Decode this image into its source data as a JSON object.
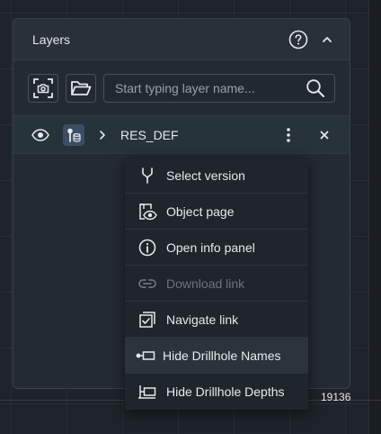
{
  "map": {
    "coordinate_readout": "19136"
  },
  "panel": {
    "title": "Layers",
    "help_icon": "question-circle-icon",
    "collapse_icon": "chevron-up-icon"
  },
  "toolbar": {
    "screenshot_icon": "camera-frame-icon",
    "open_folder_icon": "folder-open-icon",
    "search_placeholder": "Start typing layer name...",
    "search_value": "",
    "search_icon": "search-icon"
  },
  "layer": {
    "name": "RES_DEF",
    "visible": true,
    "type_icon": "drillhole-database-icon"
  },
  "context_menu": {
    "items": [
      {
        "label": "Select version",
        "icon": "version-branch-icon",
        "enabled": true
      },
      {
        "label": "Object page",
        "icon": "object-page-icon",
        "enabled": true
      },
      {
        "label": "Open info panel",
        "icon": "info-icon",
        "enabled": true
      },
      {
        "label": "Download link",
        "icon": "link-icon",
        "enabled": false
      },
      {
        "label": "Navigate link",
        "icon": "navigate-link-icon",
        "enabled": true
      },
      {
        "label": "Hide Drillhole Names",
        "icon": "hide-names-icon",
        "enabled": true
      },
      {
        "label": "Hide Drillhole Depths",
        "icon": "hide-depths-icon",
        "enabled": true
      }
    ]
  },
  "colors": {
    "background": "#1e2329",
    "panel": "#242a31",
    "selected_row": "#26333a",
    "menu": "#1f252b",
    "disabled_text": "#6c737a"
  }
}
